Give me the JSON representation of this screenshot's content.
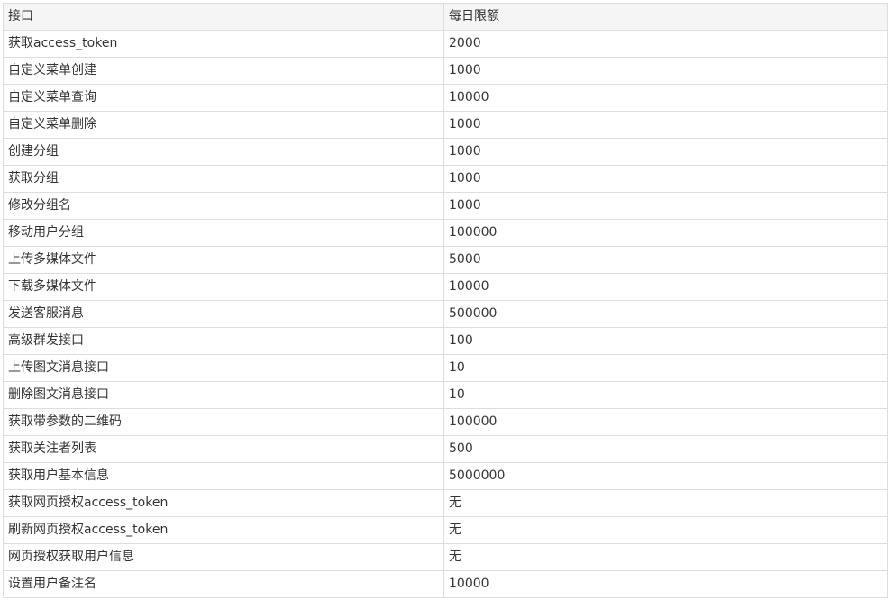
{
  "table": {
    "headers": [
      "接口",
      "每日限额"
    ],
    "rows": [
      [
        "获取access_token",
        "2000"
      ],
      [
        "自定义菜单创建",
        "1000"
      ],
      [
        "自定义菜单查询",
        "10000"
      ],
      [
        "自定义菜单删除",
        "1000"
      ],
      [
        "创建分组",
        "1000"
      ],
      [
        "获取分组",
        "1000"
      ],
      [
        "修改分组名",
        "1000"
      ],
      [
        "移动用户分组",
        "100000"
      ],
      [
        "上传多媒体文件",
        "5000"
      ],
      [
        "下载多媒体文件",
        "10000"
      ],
      [
        "发送客服消息",
        "500000"
      ],
      [
        "高级群发接口",
        "100"
      ],
      [
        "上传图文消息接口",
        "10"
      ],
      [
        "删除图文消息接口",
        "10"
      ],
      [
        "获取带参数的二维码",
        "100000"
      ],
      [
        "获取关注者列表",
        "500"
      ],
      [
        "获取用户基本信息",
        "5000000"
      ],
      [
        "获取网页授权access_token",
        "无"
      ],
      [
        "刷新网页授权access_token",
        "无"
      ],
      [
        "网页授权获取用户信息",
        "无"
      ],
      [
        "设置用户备注名",
        "10000"
      ]
    ]
  }
}
